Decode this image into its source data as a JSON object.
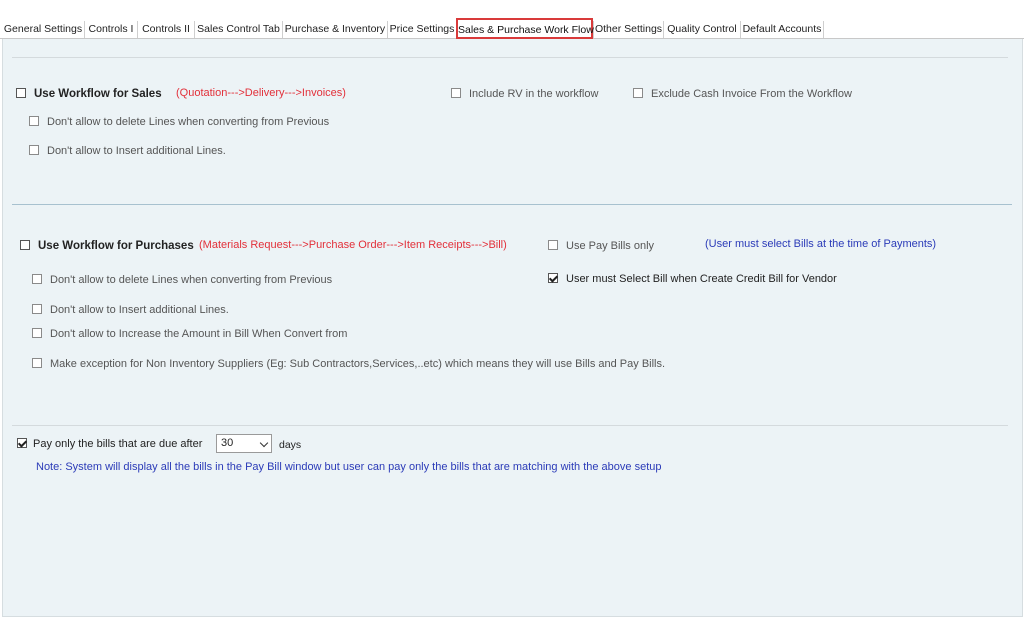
{
  "tabs": [
    {
      "label": "General Settings",
      "active": false
    },
    {
      "label": "Controls I",
      "active": false
    },
    {
      "label": "Controls II",
      "active": false
    },
    {
      "label": "Sales Control Tab",
      "active": false
    },
    {
      "label": "Purchase & Inventory",
      "active": false
    },
    {
      "label": "Price Settings",
      "active": false
    },
    {
      "label": "Sales & Purchase Work Flow",
      "active": true
    },
    {
      "label": "Other Settings",
      "active": false
    },
    {
      "label": "Quality Control",
      "active": false
    },
    {
      "label": "Default Accounts",
      "active": false
    }
  ],
  "sales": {
    "use_workflow": {
      "label": "Use Workflow for Sales",
      "checked": false
    },
    "flow_note": "(Quotation--->Delivery--->Invoices)",
    "include_rv": {
      "label": "Include RV in the workflow",
      "checked": false
    },
    "exclude_cash": {
      "label": "Exclude Cash Invoice From the Workflow",
      "checked": false
    },
    "no_delete_lines": {
      "label": "Don't allow to delete Lines when converting from Previous",
      "checked": false
    },
    "no_insert_lines": {
      "label": "Don't allow to Insert additional Lines.",
      "checked": false
    }
  },
  "purchases": {
    "use_workflow": {
      "label": "Use Workflow for Purchases",
      "checked": false
    },
    "flow_note": "(Materials Request--->Purchase Order--->Item Receipts--->Bill)",
    "use_pay_bills": {
      "label": "Use Pay Bills only",
      "checked": false
    },
    "pay_bills_note": "(User must select Bills at the time of Payments)",
    "select_bill_credit": {
      "label": "User must Select Bill when Create Credit Bill for Vendor",
      "checked": true
    },
    "no_delete_lines": {
      "label": "Don't allow to delete Lines when converting from Previous",
      "checked": false
    },
    "no_insert_lines": {
      "label": "Don't allow to Insert additional Lines.",
      "checked": false
    },
    "no_increase_amount": {
      "label": "Don't allow to Increase the Amount in Bill When Convert from",
      "checked": false
    },
    "exception_suppliers": {
      "label": "Make exception for Non Inventory Suppliers (Eg: Sub Contractors,Services,..etc) which means they will use Bills and Pay Bills.",
      "checked": false
    }
  },
  "pay_due": {
    "label": "Pay only the bills that are due after",
    "checked": true,
    "days_value": "30",
    "days_label": "days",
    "note": "Note: System will display all the bills in the Pay Bill window but user can pay only the bills that are matching with the above setup"
  }
}
